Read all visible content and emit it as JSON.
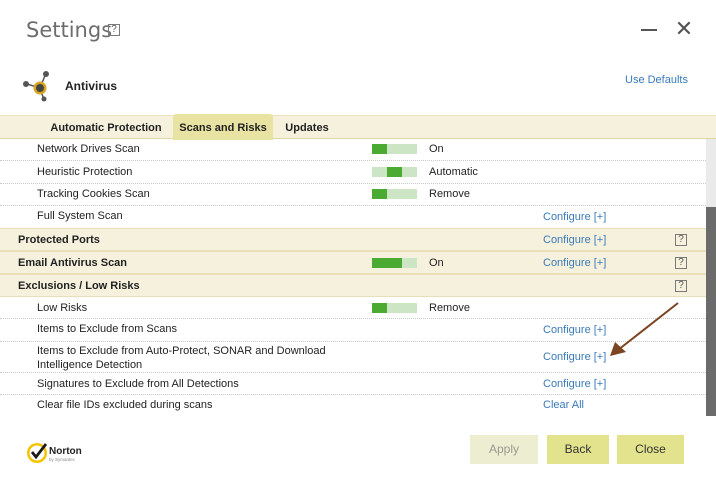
{
  "window": {
    "title": "Settings",
    "help": "?"
  },
  "section": {
    "name": "Antivirus",
    "use_defaults": "Use Defaults"
  },
  "tabs": [
    {
      "label": "Automatic Protection",
      "active": false
    },
    {
      "label": "Scans and Risks",
      "active": true
    },
    {
      "label": "Updates",
      "active": false
    }
  ],
  "rows": [
    {
      "label": "Network Drives Scan",
      "slider": "left",
      "state": "On"
    },
    {
      "label": "Heuristic Protection",
      "slider": "middle",
      "state": "Automatic"
    },
    {
      "label": "Tracking Cookies Scan",
      "slider": "left",
      "state": "Remove"
    },
    {
      "label": "Full System Scan",
      "link": "Configure [+]"
    },
    {
      "label": "Protected Ports",
      "link": "Configure [+]",
      "help": "?"
    },
    {
      "label": "Email Antivirus Scan",
      "slider": "left",
      "state": "On",
      "link": "Configure [+]",
      "help": "?"
    },
    {
      "label": "Exclusions / Low Risks",
      "help": "?"
    },
    {
      "label": "Low Risks",
      "slider": "left",
      "state": "Remove"
    },
    {
      "label": "Items to Exclude from Scans",
      "link": "Configure [+]"
    },
    {
      "label_lines": [
        "Items to Exclude from Auto-Protect, SONAR and Download",
        "Intelligence Detection"
      ],
      "link": "Configure [+]"
    },
    {
      "label": "Signatures to Exclude from All Detections",
      "link": "Configure [+]"
    },
    {
      "label": "Clear file IDs excluded during scans",
      "link": "Clear All"
    }
  ],
  "footer": {
    "brand": "Norton",
    "brand_sub": "by Symantec",
    "apply": "Apply",
    "back": "Back",
    "close": "Close"
  },
  "colors": {
    "accent_green": "#4aaa32",
    "link_blue": "#3a7ab8",
    "header_bg": "#f6f1dd",
    "button_yellow": "#e3e38e"
  },
  "icons": [
    "help-icon",
    "minimize-icon",
    "close-icon",
    "antivirus-icon",
    "annotation-arrow",
    "norton-checkmark-icon"
  ]
}
